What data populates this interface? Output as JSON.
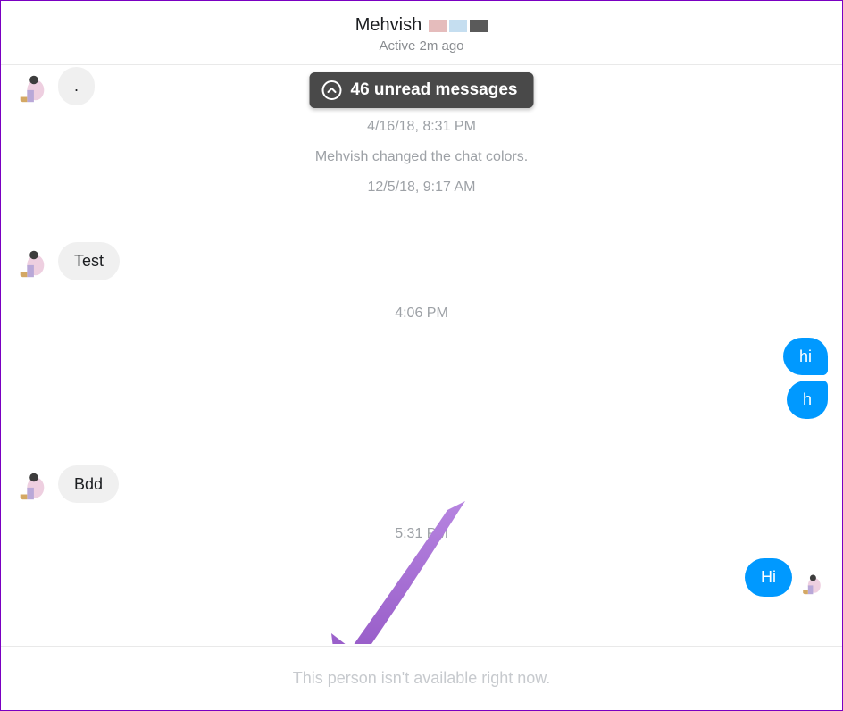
{
  "header": {
    "contact_name": "Mehvish",
    "status": "Active 2m ago"
  },
  "unread_banner": {
    "label": "46 unread messages"
  },
  "thread": {
    "top_bubble_text": ".",
    "ts1": "4/16/18, 8:31 PM",
    "system1": "Mehvish changed the chat colors.",
    "ts2": "12/5/18, 9:17 AM",
    "msg_test": "Test",
    "ts3": "4:06 PM",
    "out_hi": "hi",
    "out_h": "h",
    "msg_bdd": "Bdd",
    "ts4": "5:31 PM",
    "out_Hi": "Hi"
  },
  "footer": {
    "unavailable_text": "This person isn't available right now."
  },
  "colors": {
    "outgoing": "#0099ff",
    "incoming": "#f0f0f0",
    "accent_arrow": "#9b5fcf",
    "frame_border": "#7a00c2"
  }
}
